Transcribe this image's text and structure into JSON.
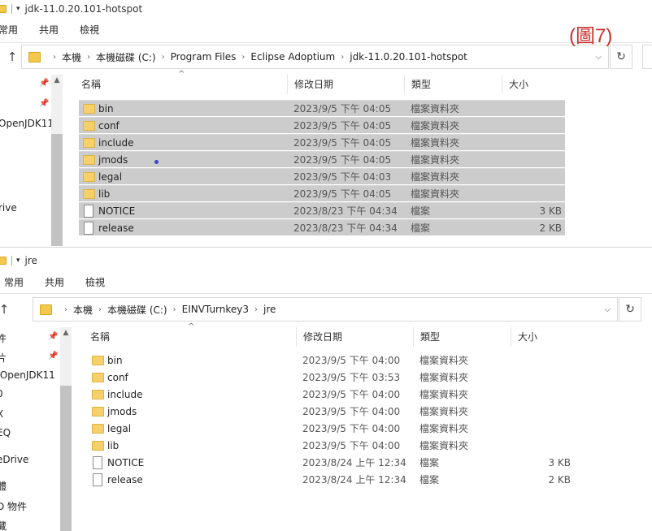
{
  "annotation": "(圖7)",
  "top_window": {
    "title": "jdk-11.0.20.101-hotspot",
    "ribbon": [
      "常用",
      "共用",
      "檢視"
    ],
    "breadcrumb": [
      "本機",
      "本機磁碟 (C:)",
      "Program Files",
      "Eclipse Adoptium",
      "jdk-11.0.20.101-hotspot"
    ],
    "sidebar": [
      "OpenJDK11",
      "rive"
    ],
    "columns": [
      "名稱",
      "修改日期",
      "類型",
      "大小"
    ],
    "files": [
      {
        "name": "bin",
        "date": "2023/9/5 下午 04:05",
        "type": "檔案資料夾",
        "size": "",
        "kind": "folder",
        "selected": true
      },
      {
        "name": "conf",
        "date": "2023/9/5 下午 04:05",
        "type": "檔案資料夾",
        "size": "",
        "kind": "folder",
        "selected": true
      },
      {
        "name": "include",
        "date": "2023/9/5 下午 04:05",
        "type": "檔案資料夾",
        "size": "",
        "kind": "folder",
        "selected": true
      },
      {
        "name": "jmods",
        "date": "2023/9/5 下午 04:05",
        "type": "檔案資料夾",
        "size": "",
        "kind": "folder",
        "selected": true
      },
      {
        "name": "legal",
        "date": "2023/9/5 下午 04:03",
        "type": "檔案資料夾",
        "size": "",
        "kind": "folder",
        "selected": true
      },
      {
        "name": "lib",
        "date": "2023/9/5 下午 04:05",
        "type": "檔案資料夾",
        "size": "",
        "kind": "folder",
        "selected": true
      },
      {
        "name": "NOTICE",
        "date": "2023/8/23 下午 04:34",
        "type": "檔案",
        "size": "3 KB",
        "kind": "file",
        "selected": true
      },
      {
        "name": "release",
        "date": "2023/8/23 下午 04:34",
        "type": "檔案",
        "size": "2 KB",
        "kind": "file",
        "selected": true
      }
    ]
  },
  "bottom_window": {
    "title": "jre",
    "ribbon": [
      "常用",
      "共用",
      "檢視"
    ],
    "breadcrumb": [
      "本機",
      "本機磁碟 (C:)",
      "EINVTurnkey3",
      "jre"
    ],
    "sidebar": [
      "件",
      "片",
      ".OpenJDK11",
      "0",
      "X",
      "EQ",
      "eDrive",
      "體",
      "D 物件",
      "藏"
    ],
    "columns": [
      "名稱",
      "修改日期",
      "類型",
      "大小"
    ],
    "files": [
      {
        "name": "bin",
        "date": "2023/9/5 下午 04:00",
        "type": "檔案資料夾",
        "size": "",
        "kind": "folder",
        "selected": false
      },
      {
        "name": "conf",
        "date": "2023/9/5 下午 03:53",
        "type": "檔案資料夾",
        "size": "",
        "kind": "folder",
        "selected": false
      },
      {
        "name": "include",
        "date": "2023/9/5 下午 04:00",
        "type": "檔案資料夾",
        "size": "",
        "kind": "folder",
        "selected": false
      },
      {
        "name": "jmods",
        "date": "2023/9/5 下午 04:00",
        "type": "檔案資料夾",
        "size": "",
        "kind": "folder",
        "selected": false
      },
      {
        "name": "legal",
        "date": "2023/9/5 下午 04:00",
        "type": "檔案資料夾",
        "size": "",
        "kind": "folder",
        "selected": false
      },
      {
        "name": "lib",
        "date": "2023/9/5 下午 04:00",
        "type": "檔案資料夾",
        "size": "",
        "kind": "folder",
        "selected": false
      },
      {
        "name": "NOTICE",
        "date": "2023/8/24 上午 12:34",
        "type": "檔案",
        "size": "3 KB",
        "kind": "file",
        "selected": false
      },
      {
        "name": "release",
        "date": "2023/8/24 上午 12:34",
        "type": "檔案",
        "size": "2 KB",
        "kind": "file",
        "selected": false
      }
    ]
  }
}
